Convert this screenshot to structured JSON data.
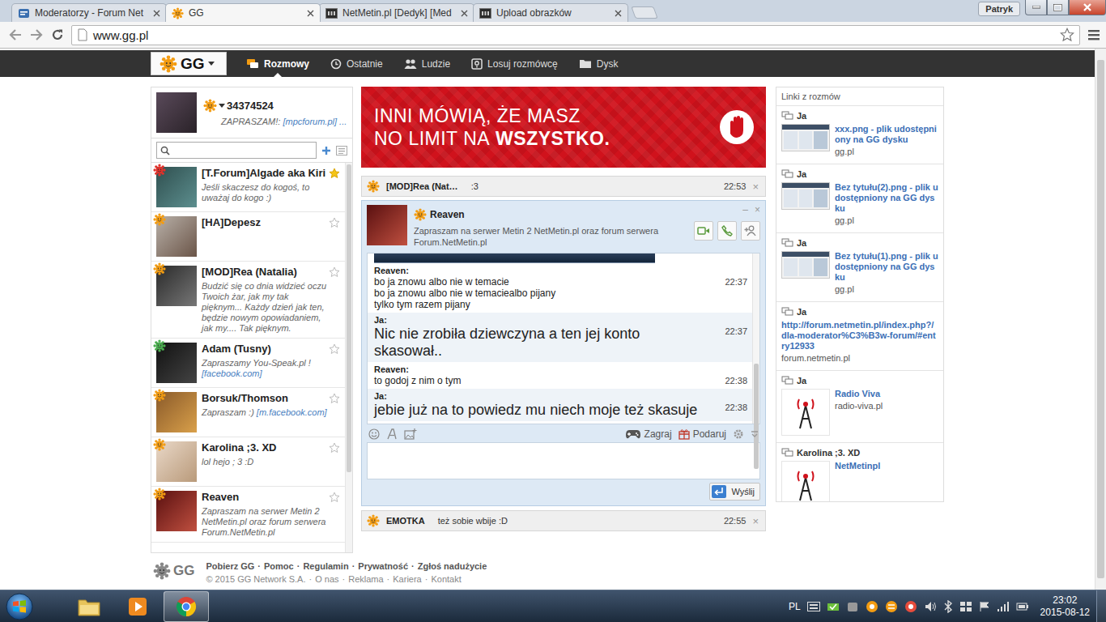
{
  "browser": {
    "tabs": [
      {
        "label": "Moderatorzy - Forum Net",
        "selected": false,
        "kind": "forum"
      },
      {
        "label": "GG",
        "selected": true,
        "kind": "gg"
      },
      {
        "label": "NetMetin.pl [Dedyk] [Med",
        "selected": false,
        "kind": "mpc"
      },
      {
        "label": "Upload obrazków",
        "selected": false,
        "kind": "mpc"
      }
    ],
    "user": "Patryk",
    "address": "www.gg.pl"
  },
  "nav": {
    "logo": "GG",
    "items": [
      {
        "label": "Rozmowy",
        "selected": true,
        "kind": "chat"
      },
      {
        "label": "Ostatnie",
        "selected": false,
        "kind": "clock"
      },
      {
        "label": "Ludzie",
        "selected": false,
        "kind": "people"
      },
      {
        "label": "Losuj rozmówcę",
        "selected": false,
        "kind": "random"
      },
      {
        "label": "Dysk",
        "selected": false,
        "kind": "folder"
      }
    ]
  },
  "profile": {
    "number": "34374524",
    "status": "ZAPRASZAM!:",
    "link": "[mpcforum.pl] ..."
  },
  "contacts": [
    {
      "name": "[T.Forum]Algade aka Kiri",
      "status": "Jeśli skaczesz do kogoś, to uważaj do kogo :)",
      "starred": true,
      "color": "#e2312a"
    },
    {
      "name": "[HA]Depesz",
      "starred": false,
      "color": "#f39c12"
    },
    {
      "name": "[MOD]Rea (Natalia)",
      "status": "Budzić się co dnia widzieć oczu Twoich żar, jak my tak pięknym... Każdy dzień jak ten, będzie nowym opowiadaniem, jak my.... Tak pięknym.",
      "starred": false,
      "color": "#f39c12"
    },
    {
      "name": "Adam (Tusny)",
      "status": "Zapraszamy You-Speak.pl !",
      "link": "[facebook.com]",
      "starred": false,
      "color": "#4caf50"
    },
    {
      "name": "Borsuk/Thomson",
      "status": "Zapraszam :)",
      "link": "[m.facebook.com]",
      "starred": false,
      "color": "#f39c12"
    },
    {
      "name": "Karolina ;3. XD",
      "status": "lol hejo ; 3 :D",
      "starred": false,
      "color": "#f39c12"
    },
    {
      "name": "Reaven",
      "status": "Zapraszam na serwer Metin 2 NetMetin.pl oraz forum serwera Forum.NetMetin.pl",
      "starred": false,
      "color": "#f39c12"
    }
  ],
  "banner": {
    "line1": "INNI MÓWIĄ, ŻE MASZ",
    "line2": "NO LIMIT NA",
    "line2_bold": "WSZYSTKO."
  },
  "chat_top": {
    "name": "[MOD]Rea (Nat…",
    "preview": ":3",
    "time": "22:53",
    "close": "×"
  },
  "chat": {
    "name": "Reaven",
    "description": "Zapraszam na serwer Metin 2 NetMetin.pl oraz forum serwera Forum.NetMetin.pl",
    "minimize": "–",
    "close": "×",
    "messages": [
      {
        "kind": "image"
      },
      {
        "kind": "other",
        "author": "Reaven:",
        "lines": [
          "bo ja znowu albo nie w temacie",
          "bo ja znowu albo nie w temaciealbo pijany",
          "tylko tym razem pijany"
        ],
        "time": "22:37"
      },
      {
        "kind": "own",
        "author": "Ja:",
        "lines": [
          "Nic nie zrobiła dziewczyna a ten jej konto skasował.."
        ],
        "time": "22:37"
      },
      {
        "kind": "other",
        "author": "Reaven:",
        "lines": [
          "to godoj z nim o tym"
        ],
        "time": "22:38"
      },
      {
        "kind": "own",
        "author": "Ja:",
        "lines": [
          "jebie już na to powiedz mu niech moje też skasuje"
        ],
        "time": "22:38"
      }
    ],
    "toolbar": {
      "game": "Zagraj",
      "gift": "Podaruj"
    },
    "send": "Wyślij"
  },
  "chat_bottom": {
    "name": "EMOTKA",
    "preview": "też sobie wbije :D",
    "time": "22:55",
    "close": "×"
  },
  "links": {
    "title": "Linki z rozmów",
    "items": [
      {
        "author": "Ja",
        "title": "xxx.png - plik udostępniony na GG dysku",
        "domain": "gg.pl",
        "kind": "file"
      },
      {
        "author": "Ja",
        "title": "Bez tytułu(2).png - plik udostępniony na GG dysku",
        "domain": "gg.pl",
        "kind": "file"
      },
      {
        "author": "Ja",
        "title": "Bez tytułu(1).png - plik udostępniony na GG dysku",
        "domain": "gg.pl",
        "kind": "file"
      },
      {
        "author": "Ja",
        "title": "http://forum.netmetin.pl/index.php?/dla-moderator%C3%B3w-forum/#entry12933",
        "domain": "forum.netmetin.pl",
        "kind": "url"
      },
      {
        "author": "Ja",
        "title": "Radio Viva",
        "domain": "radio-viva.pl",
        "kind": "site"
      },
      {
        "author": "Karolina ;3. XD",
        "title": "NetMetinpl",
        "kind": "site"
      }
    ]
  },
  "footer": {
    "logo": "GG",
    "separator": "·",
    "links": [
      "Pobierz GG",
      "Pomoc",
      "Regulamin",
      "Prywatność",
      "Zgłoś nadużycie"
    ],
    "info": [
      "© 2015 GG Network S.A.",
      "O nas",
      "Reklama",
      "Kariera",
      "Kontakt"
    ]
  },
  "taskbar": {
    "apps": [
      {
        "kind": "folder",
        "selected": false
      },
      {
        "kind": "media",
        "selected": false
      },
      {
        "kind": "browser",
        "selected": true
      }
    ],
    "lang": "PL",
    "time": "23:02",
    "date": "2015-08-12"
  }
}
